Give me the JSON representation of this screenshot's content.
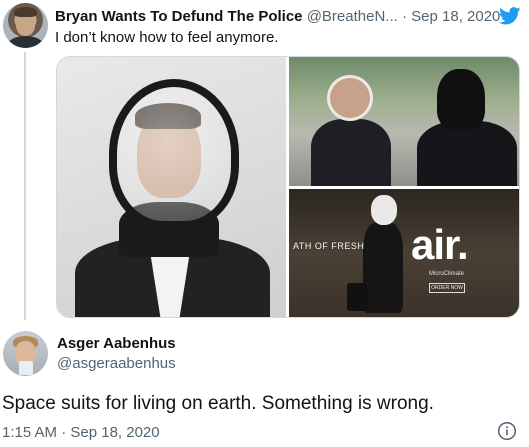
{
  "colors": {
    "twitter_blue": "#1d9bf0",
    "text_primary": "#0f1419",
    "text_secondary": "#536471",
    "divider": "#cfd9de"
  },
  "top_tweet": {
    "author_name": "Bryan Wants To Defund The Police",
    "handle": "@BreatheN...",
    "separator": "·",
    "date": "Sep 18, 2020",
    "text": "I don’t know how to feel anymore.",
    "icons": [
      "twitter-bird-icon"
    ],
    "media": {
      "promo_tagline": "ATH OF FRESH",
      "brand": "air.",
      "brand_sub": "MicroClimate",
      "order_label": "ORDER NOW"
    }
  },
  "reply_tweet": {
    "author_name": "Asger Aabenhus",
    "handle": "@asgeraabenhus",
    "text": "Space suits for living on earth. Something is wrong.",
    "timestamp": "1:15 AM · Sep 18, 2020",
    "icons": [
      "info-icon"
    ]
  }
}
